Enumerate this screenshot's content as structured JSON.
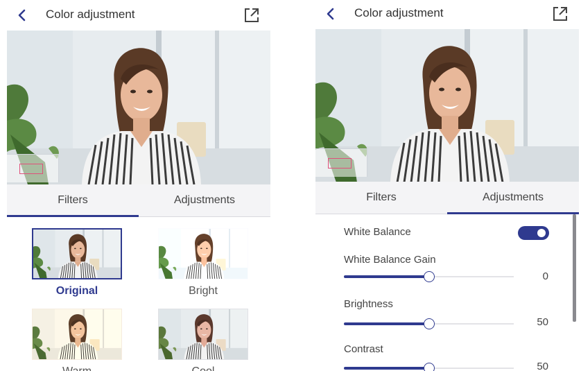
{
  "left_screen": {
    "header": {
      "title": "Color adjustment",
      "back_icon": "chevron-left-icon",
      "open_icon": "open-external-icon"
    },
    "tabs": [
      {
        "label": "Filters",
        "active": true
      },
      {
        "label": "Adjustments",
        "active": false
      }
    ],
    "filters": [
      {
        "label": "Original",
        "selected": true
      },
      {
        "label": "Bright",
        "selected": false
      },
      {
        "label": "Warm",
        "selected": false
      },
      {
        "label": "Cool",
        "selected": false
      }
    ]
  },
  "right_screen": {
    "header": {
      "title": "Color adjustment",
      "back_icon": "chevron-left-icon",
      "open_icon": "open-external-icon"
    },
    "tabs": [
      {
        "label": "Filters",
        "active": false
      },
      {
        "label": "Adjustments",
        "active": true
      }
    ],
    "white_balance": {
      "label": "White Balance",
      "enabled": true
    },
    "sliders": [
      {
        "label": "White Balance Gain",
        "value": "0",
        "level": 0.5
      },
      {
        "label": "Brightness",
        "value": "50",
        "level": 0.5
      },
      {
        "label": "Contrast",
        "value": "50",
        "level": 0.5
      }
    ]
  },
  "colors": {
    "accent": "#2f3a8f",
    "pip_border": "#e0507a",
    "tab_bg": "#f4f4f6"
  }
}
